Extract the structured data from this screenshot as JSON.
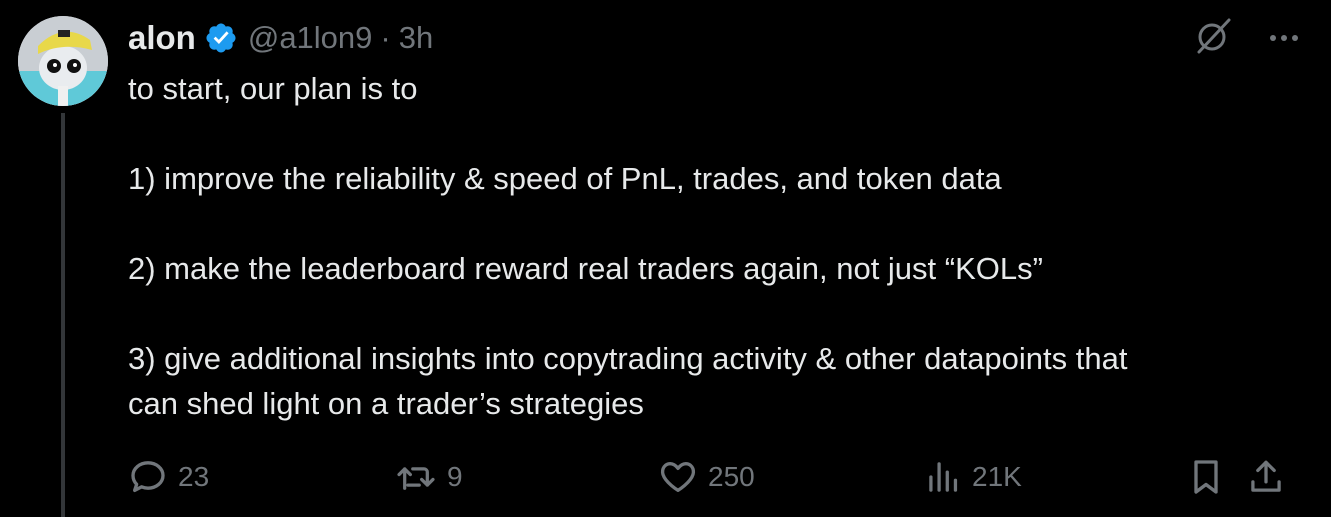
{
  "tweet": {
    "author": {
      "display_name": "alon",
      "handle": "@a1lon9",
      "separator": "·",
      "time": "3h",
      "verified_icon": "verified-badge-icon",
      "avatar_icon": "avatar-image"
    },
    "body": [
      "to start, our plan is to",
      "",
      "1) improve the reliability & speed of PnL, trades, and token data",
      "",
      "2) make the leaderboard reward real traders again, not just “KOLs”",
      "",
      "3) give additional insights into copytrading activity & other datapoints that",
      "can shed light on a trader’s strategies"
    ],
    "top_actions": {
      "grok_icon": "grok-slash-icon",
      "more_icon": "more-dots-icon"
    },
    "stats": {
      "replies": "23",
      "reposts": "9",
      "likes": "250",
      "views": "21K"
    }
  },
  "colors": {
    "background": "#000000",
    "text_primary": "#e7e9ea",
    "text_secondary": "#71767b",
    "verified_blue": "#1d9bf0",
    "thread_line": "#333639"
  }
}
